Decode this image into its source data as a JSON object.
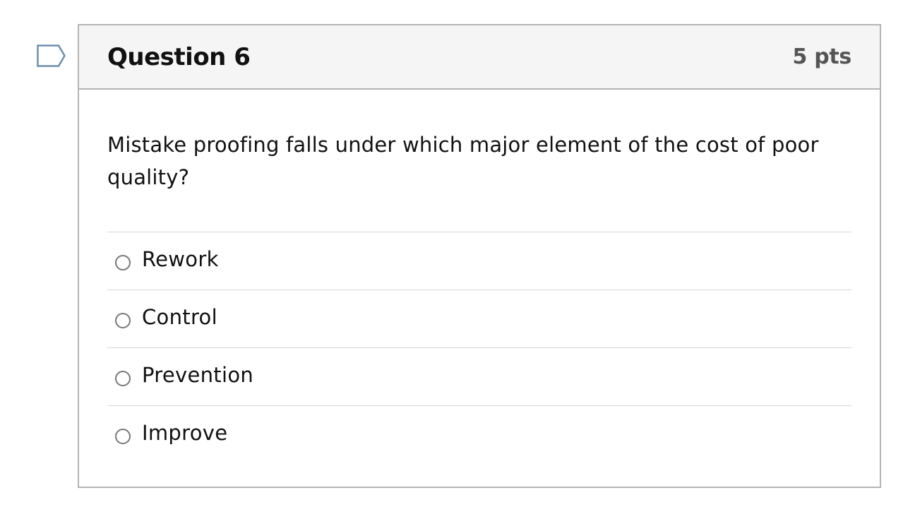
{
  "flag": {
    "icon": "bookmark-flag-icon",
    "color": "#6b8fb0"
  },
  "question": {
    "title": "Question 6",
    "points": "5 pts",
    "text": "Mistake proofing falls under which major element of the cost of poor quality?",
    "answers": [
      {
        "label": "Rework",
        "selected": false
      },
      {
        "label": "Control",
        "selected": false
      },
      {
        "label": "Prevention",
        "selected": false
      },
      {
        "label": "Improve",
        "selected": false
      }
    ]
  }
}
